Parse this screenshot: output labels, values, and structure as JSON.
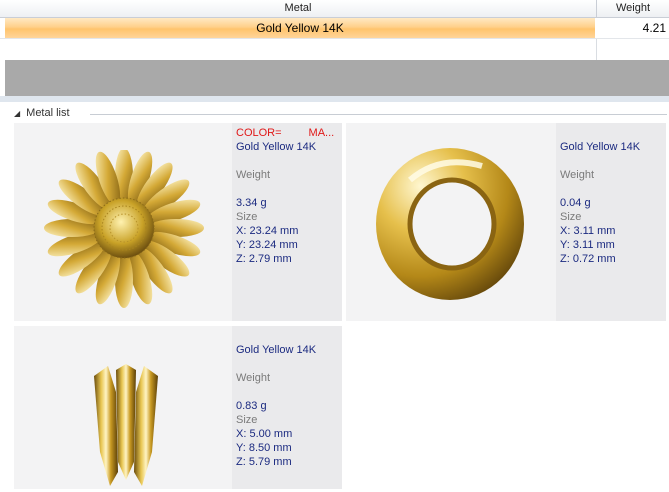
{
  "table": {
    "headers": {
      "metal": "Metal",
      "weight": "Weight"
    },
    "rows": [
      {
        "metal": "Gold Yellow 14K",
        "weight": "4.21"
      }
    ]
  },
  "metal_list": {
    "title": "Metal list",
    "color_header": {
      "label": "COLOR=",
      "value": "MA..."
    },
    "items": [
      {
        "name": "Gold Yellow 14K",
        "weight_label": "Weight",
        "weight": "3.34 g",
        "size_label": "Size",
        "x": "X: 23.24 mm",
        "y": "Y: 23.24 mm",
        "z": "Z: 2.79 mm",
        "icon": "daisy-flower-pendant"
      },
      {
        "name": "Gold Yellow 14K",
        "weight_label": "Weight",
        "weight": "0.04 g",
        "size_label": "Size",
        "x": "X: 3.11 mm",
        "y": "Y: 3.11 mm",
        "z": "Z: 0.72 mm",
        "icon": "gold-ring"
      },
      {
        "name": "Gold Yellow 14K",
        "weight_label": "Weight",
        "weight": "0.83 g",
        "size_label": "Size",
        "x": "X: 5.00 mm",
        "y": "Y: 8.50 mm",
        "z": "Z: 5.79 mm",
        "icon": "bail-prong"
      }
    ]
  },
  "colors": {
    "gold": "#c9a227",
    "selection": "#ffc46c",
    "accent_text": "#1b2a80",
    "alert_text": "#e01818"
  }
}
